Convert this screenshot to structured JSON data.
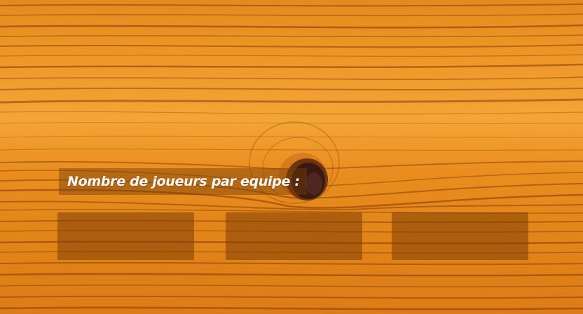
{
  "prompt": {
    "label": "Nombre de joueurs par equipe :"
  },
  "options": [
    {
      "label": ""
    },
    {
      "label": ""
    },
    {
      "label": ""
    }
  ],
  "colors": {
    "wood_light": "#f3a636",
    "wood_mid": "#e48a1e",
    "grain_dark": "#8a3e0a",
    "knot_center": "#3a1a10",
    "panel": "#803e06"
  }
}
